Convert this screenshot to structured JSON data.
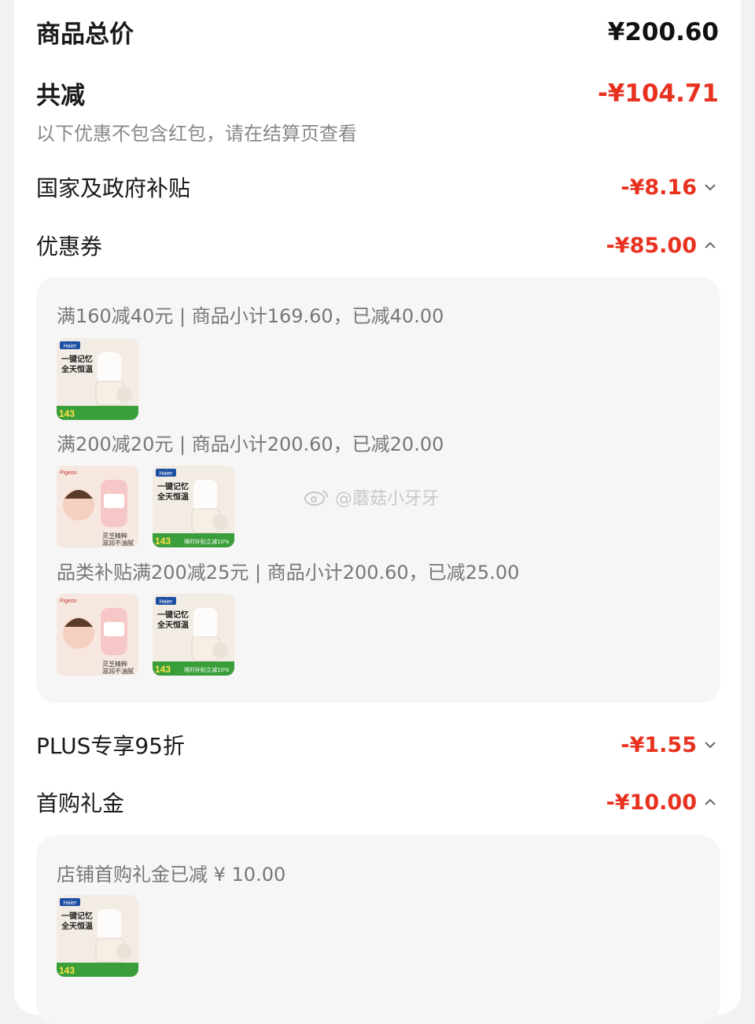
{
  "summary": {
    "total_label": "商品总价",
    "total_value": "¥200.60",
    "discount_label": "共减",
    "discount_value": "-¥104.71",
    "note": "以下优惠不包含红包，请在结算页查看"
  },
  "lines": {
    "gov": {
      "label": "国家及政府补贴",
      "value": "-¥8.16",
      "chevron": "chevron-down-icon"
    },
    "coupon": {
      "label": "优惠券",
      "value": "-¥85.00",
      "chevron": "chevron-up-icon"
    },
    "plus": {
      "label": "PLUS专享95折",
      "value": "-¥1.55",
      "chevron": "chevron-down-icon"
    },
    "first": {
      "label": "首购礼金",
      "value": "-¥10.00",
      "chevron": "chevron-up-icon"
    }
  },
  "coupon_groups": [
    {
      "title": "满160减40元 | 商品小计169.60，已减40.00"
    },
    {
      "title": "满200减20元 | 商品小计200.60，已减20.00"
    },
    {
      "title": "品类补贴满200减25元 | 商品小计200.60，已减25.00"
    }
  ],
  "first_group": {
    "title": "店铺首购礼金已减 ¥ 10.00"
  },
  "watermark": "@蘑菇小牙牙",
  "products": {
    "kettle": {
      "brand": "Haier",
      "headline1": "一键记忆",
      "headline2": "全天恒温",
      "badge": "143",
      "footer": "限时补贴立减10%"
    },
    "baby": {
      "brand": "Pigeon",
      "caption1": "灵芝精粹",
      "caption2": "滋润不油腻"
    }
  }
}
